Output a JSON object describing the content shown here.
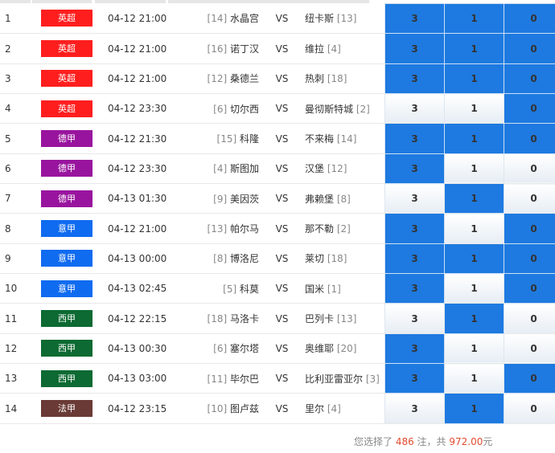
{
  "colors": {
    "selected": "#1e7ae0",
    "premier": "#ff1e1e",
    "bundesliga": "#99149e",
    "seriea": "#0f6bf0",
    "laliga": "#0c6a32",
    "ligue1": "#6a3a36"
  },
  "matches": [
    {
      "idx": "1",
      "league": "英超",
      "color": "#ff1e1e",
      "time": "04-12 21:00",
      "home_rank": "[14]",
      "home": "水晶宫",
      "vs": "VS",
      "away": "纽卡斯",
      "away_rank": "[13]",
      "odds": [
        "3",
        "1",
        "0"
      ],
      "selected": [
        true,
        true,
        true
      ]
    },
    {
      "idx": "2",
      "league": "英超",
      "color": "#ff1e1e",
      "time": "04-12 21:00",
      "home_rank": "[16]",
      "home": "诺丁汉",
      "vs": "VS",
      "away": "维拉",
      "away_rank": "[4]",
      "odds": [
        "3",
        "1",
        "0"
      ],
      "selected": [
        true,
        true,
        true
      ]
    },
    {
      "idx": "3",
      "league": "英超",
      "color": "#ff1e1e",
      "time": "04-12 21:00",
      "home_rank": "[12]",
      "home": "桑德兰",
      "vs": "VS",
      "away": "热刺",
      "away_rank": "[18]",
      "odds": [
        "3",
        "1",
        "0"
      ],
      "selected": [
        true,
        true,
        true
      ]
    },
    {
      "idx": "4",
      "league": "英超",
      "color": "#ff1e1e",
      "time": "04-12 23:30",
      "home_rank": "[6]",
      "home": "切尔西",
      "vs": "VS",
      "away": "曼彻斯特城",
      "away_rank": "[2]",
      "odds": [
        "3",
        "1",
        "0"
      ],
      "selected": [
        false,
        false,
        true
      ]
    },
    {
      "idx": "5",
      "league": "德甲",
      "color": "#99149e",
      "time": "04-12 21:30",
      "home_rank": "[15]",
      "home": "科隆",
      "vs": "VS",
      "away": "不来梅",
      "away_rank": "[14]",
      "odds": [
        "3",
        "1",
        "0"
      ],
      "selected": [
        true,
        true,
        true
      ]
    },
    {
      "idx": "6",
      "league": "德甲",
      "color": "#99149e",
      "time": "04-12 23:30",
      "home_rank": "[4]",
      "home": "斯图加",
      "vs": "VS",
      "away": "汉堡",
      "away_rank": "[12]",
      "odds": [
        "3",
        "1",
        "0"
      ],
      "selected": [
        true,
        false,
        false
      ]
    },
    {
      "idx": "7",
      "league": "德甲",
      "color": "#99149e",
      "time": "04-13 01:30",
      "home_rank": "[9]",
      "home": "美因茨",
      "vs": "VS",
      "away": "弗赖堡",
      "away_rank": "[8]",
      "odds": [
        "3",
        "1",
        "0"
      ],
      "selected": [
        false,
        true,
        false
      ]
    },
    {
      "idx": "8",
      "league": "意甲",
      "color": "#0f6bf0",
      "time": "04-12 21:00",
      "home_rank": "[13]",
      "home": "帕尔马",
      "vs": "VS",
      "away": "那不勒",
      "away_rank": "[2]",
      "odds": [
        "3",
        "1",
        "0"
      ],
      "selected": [
        true,
        false,
        true
      ]
    },
    {
      "idx": "9",
      "league": "意甲",
      "color": "#0f6bf0",
      "time": "04-13 00:00",
      "home_rank": "[8]",
      "home": "博洛尼",
      "vs": "VS",
      "away": "莱切",
      "away_rank": "[18]",
      "odds": [
        "3",
        "1",
        "0"
      ],
      "selected": [
        true,
        true,
        true
      ]
    },
    {
      "idx": "10",
      "league": "意甲",
      "color": "#0f6bf0",
      "time": "04-13 02:45",
      "home_rank": "[5]",
      "home": "科莫",
      "vs": "VS",
      "away": "国米",
      "away_rank": "[1]",
      "odds": [
        "3",
        "1",
        "0"
      ],
      "selected": [
        true,
        false,
        true
      ]
    },
    {
      "idx": "11",
      "league": "西甲",
      "color": "#0c6a32",
      "time": "04-12 22:15",
      "home_rank": "[18]",
      "home": "马洛卡",
      "vs": "VS",
      "away": "巴列卡",
      "away_rank": "[13]",
      "odds": [
        "3",
        "1",
        "0"
      ],
      "selected": [
        false,
        true,
        false
      ]
    },
    {
      "idx": "12",
      "league": "西甲",
      "color": "#0c6a32",
      "time": "04-13 00:30",
      "home_rank": "[6]",
      "home": "塞尔塔",
      "vs": "VS",
      "away": "奥维耶",
      "away_rank": "[20]",
      "odds": [
        "3",
        "1",
        "0"
      ],
      "selected": [
        true,
        false,
        false
      ]
    },
    {
      "idx": "13",
      "league": "西甲",
      "color": "#0c6a32",
      "time": "04-13 03:00",
      "home_rank": "[11]",
      "home": "毕尔巴",
      "vs": "VS",
      "away": "比利亚雷亚尔",
      "away_rank": "[3]",
      "odds": [
        "3",
        "1",
        "0"
      ],
      "selected": [
        true,
        false,
        true
      ]
    },
    {
      "idx": "14",
      "league": "法甲",
      "color": "#6a3a36",
      "time": "04-12 23:15",
      "home_rank": "[10]",
      "home": "图卢兹",
      "vs": "VS",
      "away": "里尔",
      "away_rank": "[4]",
      "odds": [
        "3",
        "1",
        "0"
      ],
      "selected": [
        false,
        true,
        false
      ]
    }
  ],
  "summary": {
    "prefix": "您选择了 ",
    "count": "486",
    "mid": " 注，共 ",
    "amount": "972.00",
    "suffix": "元"
  }
}
